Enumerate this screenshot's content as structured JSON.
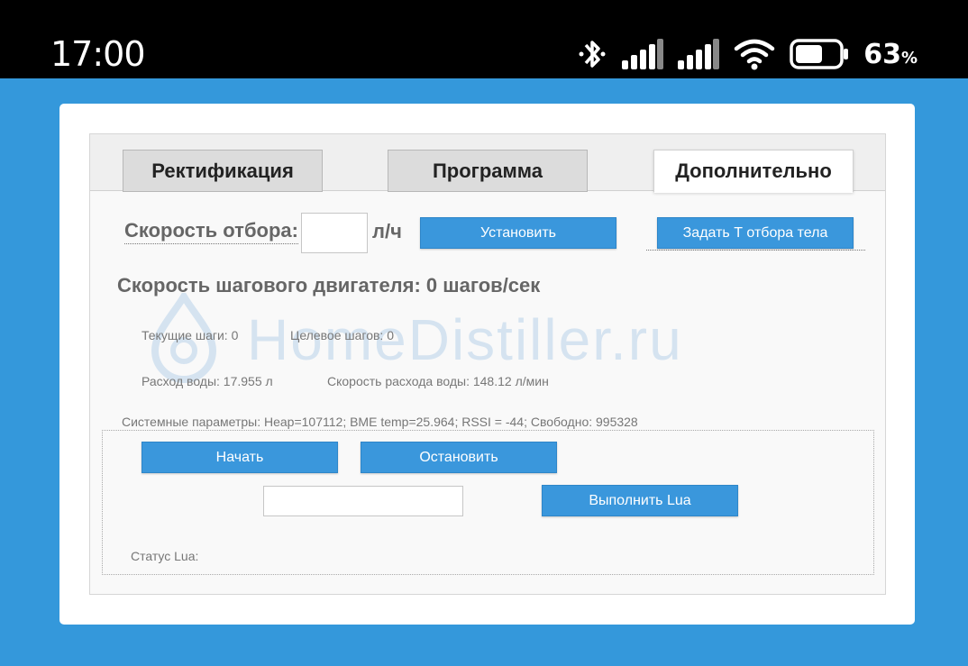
{
  "statusbar": {
    "time": "17:00",
    "battery_percent": "63",
    "battery_suffix": "%",
    "battery_level": 0.63,
    "icons": [
      "bluetooth-icon",
      "signal-icon",
      "signal-icon",
      "wifi-icon",
      "battery-icon"
    ]
  },
  "tabs": [
    {
      "label": "Ректификация",
      "active": false
    },
    {
      "label": "Программа",
      "active": false
    },
    {
      "label": "Дополнительно",
      "active": true
    }
  ],
  "watermark": {
    "text": "HomeDistiller.ru"
  },
  "speed": {
    "label": "Скорость отбора:",
    "value": "",
    "unit": "л/ч",
    "set_button": "Установить",
    "body_button": "Задать Т отбора тела"
  },
  "motor": {
    "heading": "Скорость шагового двигателя: 0 шагов/сек",
    "current_steps": "Текущие шаги: 0",
    "target_steps": "Целевое шагов: 0",
    "water_flow": "Расход воды: 17.955 л",
    "water_rate": "Скорость расхода воды: 148.12 л/мин"
  },
  "system": {
    "params": "Системные параметры: Heap=107112; BME temp=25.964; RSSI = -44; Свободно: 995328"
  },
  "lua": {
    "start_button": "Начать",
    "stop_button": "Остановить",
    "input_value": "",
    "run_button": "Выполнить Lua",
    "status": "Статус Lua:"
  },
  "colors": {
    "accent": "#3498db",
    "button": "#3a97dc",
    "text_muted": "#777777"
  }
}
